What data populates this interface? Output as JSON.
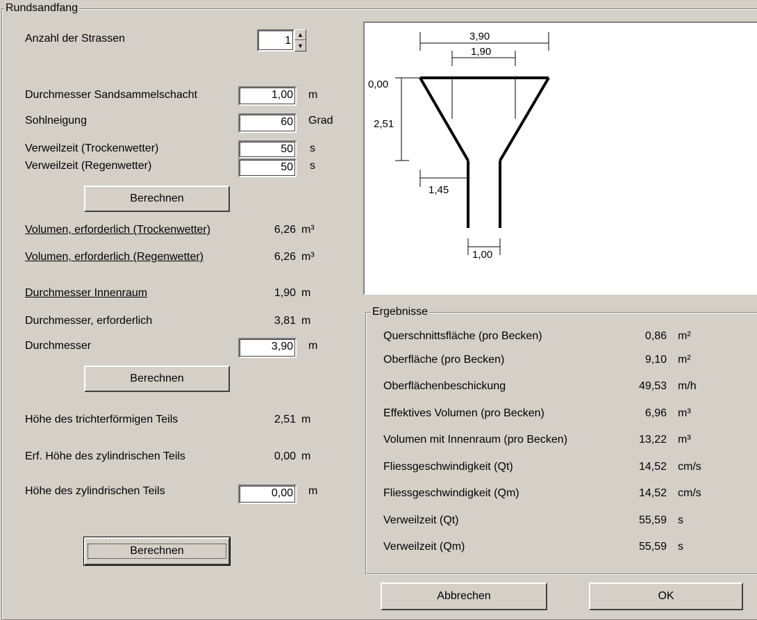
{
  "group_title": "Rundsandfang",
  "strassen": {
    "label": "Anzahl der Strassen",
    "value": "1"
  },
  "left": {
    "durchmesser_schacht": {
      "label": "Durchmesser Sandsammelschacht",
      "value": "1,00",
      "unit": "m"
    },
    "sohlneigung": {
      "label": "Sohlneigung",
      "value": "60",
      "unit": "Grad"
    },
    "verweil_trocken": {
      "label": "Verweilzeit (Trockenwetter)",
      "value": "50",
      "unit": "s"
    },
    "verweil_regen": {
      "label": "Verweilzeit (Regenwetter)",
      "value": "50",
      "unit": "s"
    },
    "berechnen1": "Berechnen",
    "vol_trocken": {
      "label": "Volumen, erforderlich (Trockenwetter)",
      "value": "6,26",
      "unit": "m³"
    },
    "vol_regen": {
      "label": "Volumen, erforderlich (Regenwetter)",
      "value": "6,26",
      "unit": "m³"
    },
    "d_innen": {
      "label": "Durchmesser Innenraum",
      "value": "1,90",
      "unit": "m"
    },
    "d_erf": {
      "label": "Durchmesser, erforderlich",
      "value": "3,81",
      "unit": "m"
    },
    "d": {
      "label": "Durchmesser",
      "value": "3,90",
      "unit": "m"
    },
    "berechnen2": "Berechnen",
    "h_trichter": {
      "label": "Höhe des trichterförmigen Teils",
      "value": "2,51",
      "unit": "m"
    },
    "h_erf_zyl": {
      "label": "Erf. Höhe des zylindrischen Teils",
      "value": "0,00",
      "unit": "m"
    },
    "h_zyl": {
      "label": "Höhe des zylindrischen Teils",
      "value": "0,00",
      "unit": "m"
    },
    "berechnen3": "Berechnen"
  },
  "diagram": {
    "top_width": "3,90",
    "inner_width": "1,90",
    "top_level": "0,00",
    "height": "2,51",
    "offset": "1,45",
    "bottom_width": "1,00"
  },
  "results": {
    "title": "Ergebnisse",
    "rows": [
      {
        "label": "Querschnittsfläche (pro Becken)",
        "value": "0,86",
        "unit": "m²"
      },
      {
        "label": "Oberfläche (pro Becken)",
        "value": "9,10",
        "unit": "m²"
      },
      {
        "label": "Oberflächenbeschickung",
        "value": "49,53",
        "unit": "m/h"
      },
      {
        "label": "Effektives Volumen (pro Becken)",
        "value": "6,96",
        "unit": "m³"
      },
      {
        "label": "Volumen mit Innenraum (pro Becken)",
        "value": "13,22",
        "unit": "m³"
      },
      {
        "label": "Fliessgeschwindigkeit (Qt)",
        "value": "14,52",
        "unit": "cm/s"
      },
      {
        "label": "Fliessgeschwindigkeit (Qm)",
        "value": "14,52",
        "unit": "cm/s"
      },
      {
        "label": "Verweilzeit (Qt)",
        "value": "55,59",
        "unit": "s"
      },
      {
        "label": "Verweilzeit (Qm)",
        "value": "55,59",
        "unit": "s"
      }
    ]
  },
  "buttons": {
    "cancel": "Abbrechen",
    "ok": "OK"
  }
}
